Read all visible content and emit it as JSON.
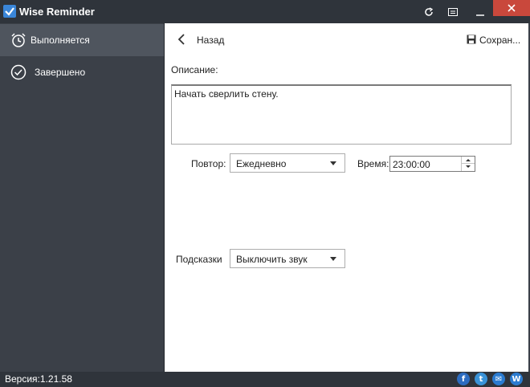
{
  "app": {
    "title": "Wise Reminder",
    "accent": "#3a86d9",
    "close_color": "#c9483c"
  },
  "titlebar": {
    "icons": [
      "refresh-icon",
      "menu-icon",
      "minimize-icon",
      "close-icon"
    ]
  },
  "sidebar": {
    "items": [
      {
        "label": "Выполняется",
        "icon": "alarm-clock-icon",
        "active": true
      },
      {
        "label": "Завершено",
        "icon": "check-circle-icon",
        "active": false
      }
    ]
  },
  "toolbar": {
    "back_label": "Назад",
    "save_label": "Сохран..."
  },
  "form": {
    "description_label": "Описание:",
    "description_value": "Начать сверлить стену.",
    "repeat_label": "Повтор:",
    "repeat_value": "Ежедневно",
    "time_label": "Время:",
    "time_value": "23:00:00",
    "hints_label": "Подсказки",
    "hints_value": "Выключить звук"
  },
  "status": {
    "version": "Версия:1.21.58",
    "social": [
      "f",
      "t",
      "✉",
      "W"
    ]
  }
}
